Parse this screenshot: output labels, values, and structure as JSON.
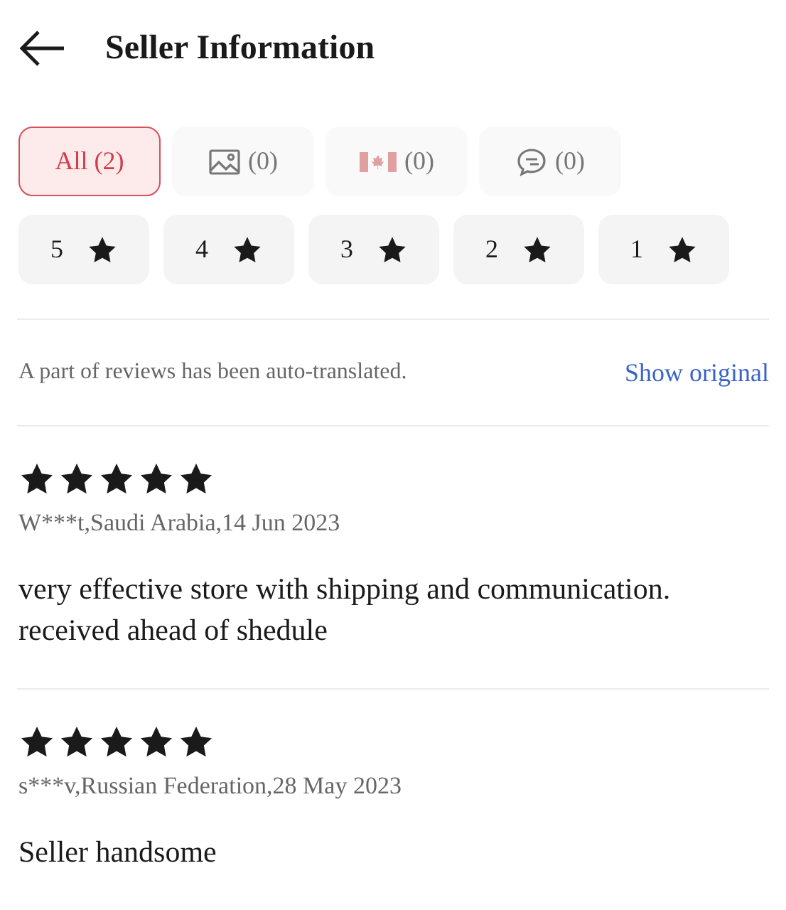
{
  "header": {
    "title": "Seller Information"
  },
  "filters": [
    {
      "kind": "all",
      "label": "All (2)",
      "selected": true
    },
    {
      "kind": "photo",
      "label": "(0)",
      "selected": false
    },
    {
      "kind": "flag",
      "label": "(0)",
      "selected": false
    },
    {
      "kind": "comment",
      "label": "(0)",
      "selected": false
    }
  ],
  "star_filters": [
    {
      "label": "5",
      "selected": false
    },
    {
      "label": "4",
      "selected": false
    },
    {
      "label": "3",
      "selected": false
    },
    {
      "label": "2",
      "selected": false
    },
    {
      "label": "1",
      "selected": false
    }
  ],
  "translation_note": {
    "text": "A part of reviews has been auto-translated.",
    "link": "Show original"
  },
  "reviews": [
    {
      "stars": 5,
      "meta": "W***t,Saudi Arabia,14 Jun 2023",
      "text": "very effective store with shipping and communication. received ahead of shedule"
    },
    {
      "stars": 5,
      "meta": "s***v,Russian Federation,28 May 2023",
      "text": "Seller handsome"
    }
  ]
}
